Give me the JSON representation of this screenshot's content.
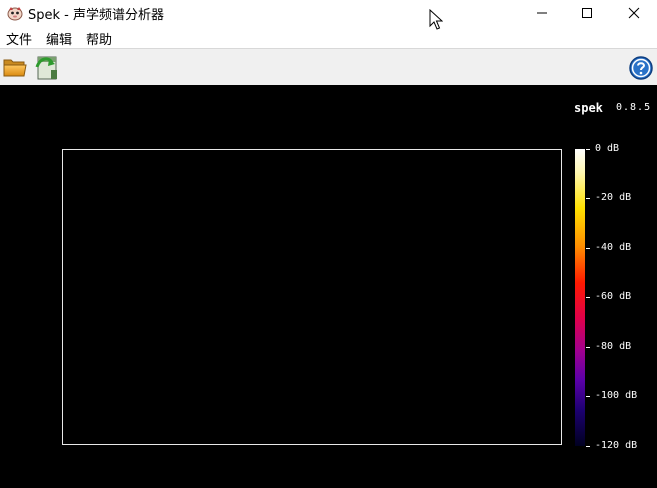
{
  "window": {
    "title": "Spek - 声学频谱分析器",
    "app_icon": "spek-app-icon",
    "controls": [
      "minimize-icon",
      "maximize-icon",
      "close-icon"
    ]
  },
  "menu": {
    "file": "文件",
    "edit": "编辑",
    "help": "帮助"
  },
  "toolbar": {
    "buttons": [
      "open-file-icon",
      "save-file-icon",
      "help-icon"
    ]
  },
  "spectrogram": {
    "brand": "spek",
    "version": "0.8.5",
    "db_scale": [
      "0 dB",
      "-20 dB",
      "-40 dB",
      "-60 dB",
      "-80 dB",
      "-100 dB",
      "-120 dB"
    ],
    "colors": {
      "background": "#000000",
      "frame": "#e8e8e8",
      "scale_top": "#ffffff",
      "scale_mid": "#ff1a00",
      "scale_bottom": "#000020"
    }
  }
}
